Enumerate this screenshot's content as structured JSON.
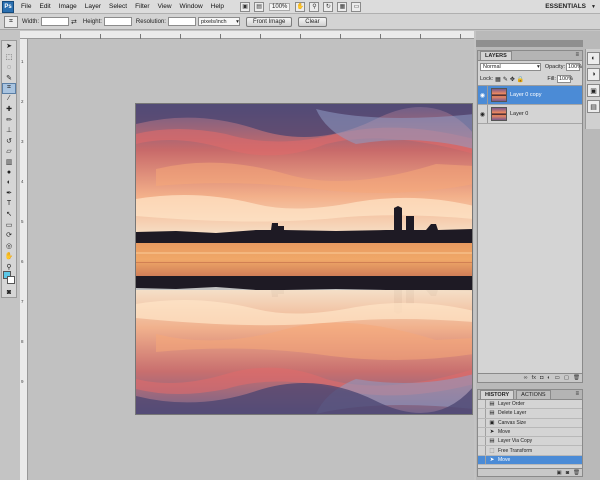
{
  "menubar": {
    "logo": "Ps",
    "items": [
      "File",
      "Edit",
      "Image",
      "Layer",
      "Select",
      "Filter",
      "View",
      "Window",
      "Help"
    ],
    "zoom": "100%",
    "workspace": "ESSENTIALS"
  },
  "options": {
    "width_label": "Width:",
    "width_value": "",
    "height_label": "Height:",
    "height_value": "",
    "resolution_label": "Resolution:",
    "resolution_value": "",
    "resolution_unit": "pixels/inch",
    "front_image_label": "Front Image",
    "clear_label": "Clear"
  },
  "toolbox": {
    "tools": [
      "move-icon",
      "marquee-icon",
      "lasso-icon",
      "quick-select-icon",
      "crop-icon",
      "eyedropper-icon",
      "healing-brush-icon",
      "brush-icon",
      "clone-stamp-icon",
      "history-brush-icon",
      "eraser-icon",
      "gradient-icon",
      "blur-icon",
      "dodge-icon",
      "pen-icon",
      "type-icon",
      "path-select-icon",
      "rectangle-icon",
      "3d-rotate-icon",
      "3d-orbit-icon",
      "hand-icon",
      "zoom-icon"
    ],
    "foreground_color": "#5cc7e6",
    "background_color": "#ffffff"
  },
  "rulers": {
    "left_numbers": [
      "1",
      "2",
      "3",
      "4",
      "5",
      "6",
      "7",
      "8",
      "9"
    ]
  },
  "layers_panel": {
    "tab": "LAYERS",
    "blend_mode": "Normal",
    "opacity_label": "Opacity:",
    "opacity_value": "100%",
    "lock_label": "Lock:",
    "fill_label": "Fill:",
    "fill_value": "100%",
    "layers": [
      {
        "name": "Layer 0 copy",
        "selected": true
      },
      {
        "name": "Layer 0",
        "selected": false
      }
    ]
  },
  "history_panel": {
    "tabs": [
      "HISTORY",
      "ACTIONS"
    ],
    "items": [
      {
        "label": "Layer Order",
        "icon": "layer-order-icon",
        "selected": false
      },
      {
        "label": "Delete Layer",
        "icon": "delete-layer-icon",
        "selected": false
      },
      {
        "label": "Canvas Size",
        "icon": "canvas-size-icon",
        "selected": false
      },
      {
        "label": "Move",
        "icon": "move-icon",
        "selected": false
      },
      {
        "label": "Layer Via Copy",
        "icon": "layer-copy-icon",
        "selected": false
      },
      {
        "label": "Free Transform",
        "icon": "transform-icon",
        "selected": false
      },
      {
        "label": "Move",
        "icon": "move-icon",
        "selected": true
      }
    ]
  },
  "colors": {
    "selection": "#4b8bd6",
    "app_bg": "#c4c4c4"
  }
}
